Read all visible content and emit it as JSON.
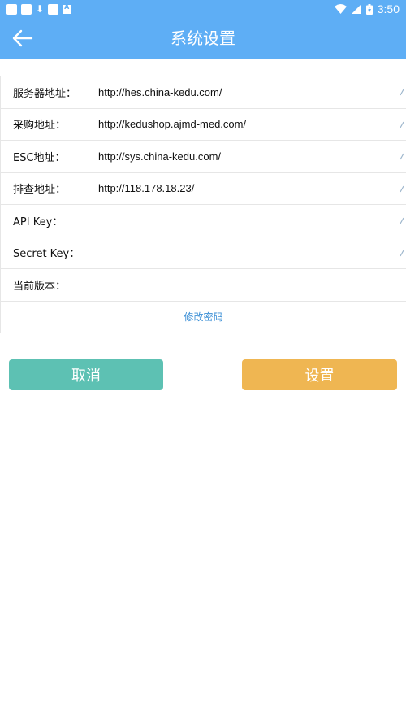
{
  "status": {
    "time": "3:50"
  },
  "header": {
    "title": "系统设置"
  },
  "form": {
    "rows": [
      {
        "label": "服务器地址：",
        "value": "http://hes.china-kedu.com/"
      },
      {
        "label": "采购地址：",
        "value": "http://kedushop.ajmd-med.com/"
      },
      {
        "label": "ESC地址：",
        "value": "http://sys.china-kedu.com/"
      },
      {
        "label": "排查地址：",
        "value": "http://118.178.18.23/"
      },
      {
        "label": "API Key：",
        "value": ""
      },
      {
        "label": "Secret Key：",
        "value": ""
      },
      {
        "label": "当前版本：",
        "value": ""
      }
    ],
    "change_password_label": "修改密码"
  },
  "buttons": {
    "cancel_label": "取消",
    "set_label": "设置"
  },
  "colors": {
    "header": "#5eaef5",
    "cancel": "#5dc1b3",
    "set": "#efb652",
    "link": "#3b8fd6"
  }
}
